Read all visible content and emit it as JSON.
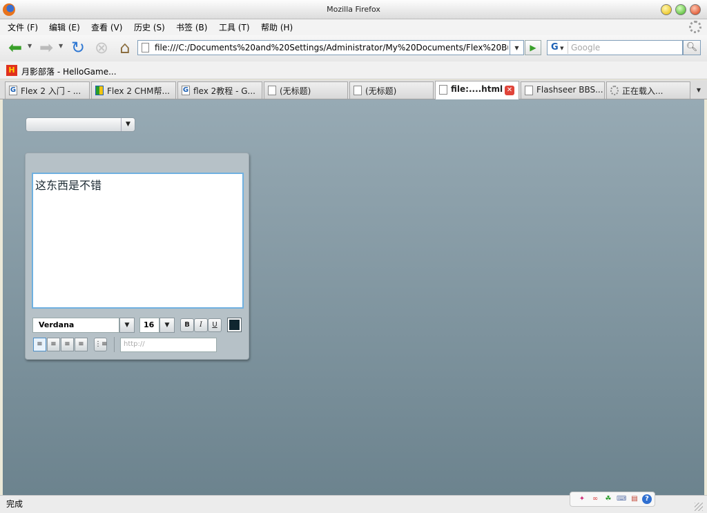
{
  "window": {
    "title": "Mozilla Firefox"
  },
  "menu": [
    "文件 (F)",
    "编辑 (E)",
    "查看 (V)",
    "历史 (S)",
    "书签 (B)",
    "工具 (T)",
    "帮助 (H)"
  ],
  "nav": {
    "url": "file:///C:/Documents%20and%20Settings/Administrator/My%20Documents/Flex%20Builder%",
    "search_placeholder": "Google",
    "search_engine": "G"
  },
  "bookmarks": [
    {
      "label": "月影部落 - HelloGame..."
    }
  ],
  "tabs": [
    {
      "label": "Flex 2 入门 - ...",
      "icon": "google-icon"
    },
    {
      "label": "Flex 2 CHM帮...",
      "icon": "chm-icon"
    },
    {
      "label": "flex 2教程 - G...",
      "icon": "google-icon"
    },
    {
      "label": "(无标题)",
      "icon": "page-icon"
    },
    {
      "label": "(无标题)",
      "icon": "page-icon"
    },
    {
      "label": "file:....html",
      "icon": "page-icon",
      "active": true
    },
    {
      "label": "Flashseer BBS...",
      "icon": "page-icon"
    },
    {
      "label": "正在载入...",
      "icon": "loading-icon"
    }
  ],
  "app": {
    "combo_value": "",
    "editor_text": "这东西是不错",
    "font": "Verdana",
    "font_size": "16",
    "bold": "B",
    "italic": "I",
    "underline": "U",
    "text_color": "#10262f",
    "link_placeholder": "http://"
  },
  "status": {
    "text": "完成"
  }
}
